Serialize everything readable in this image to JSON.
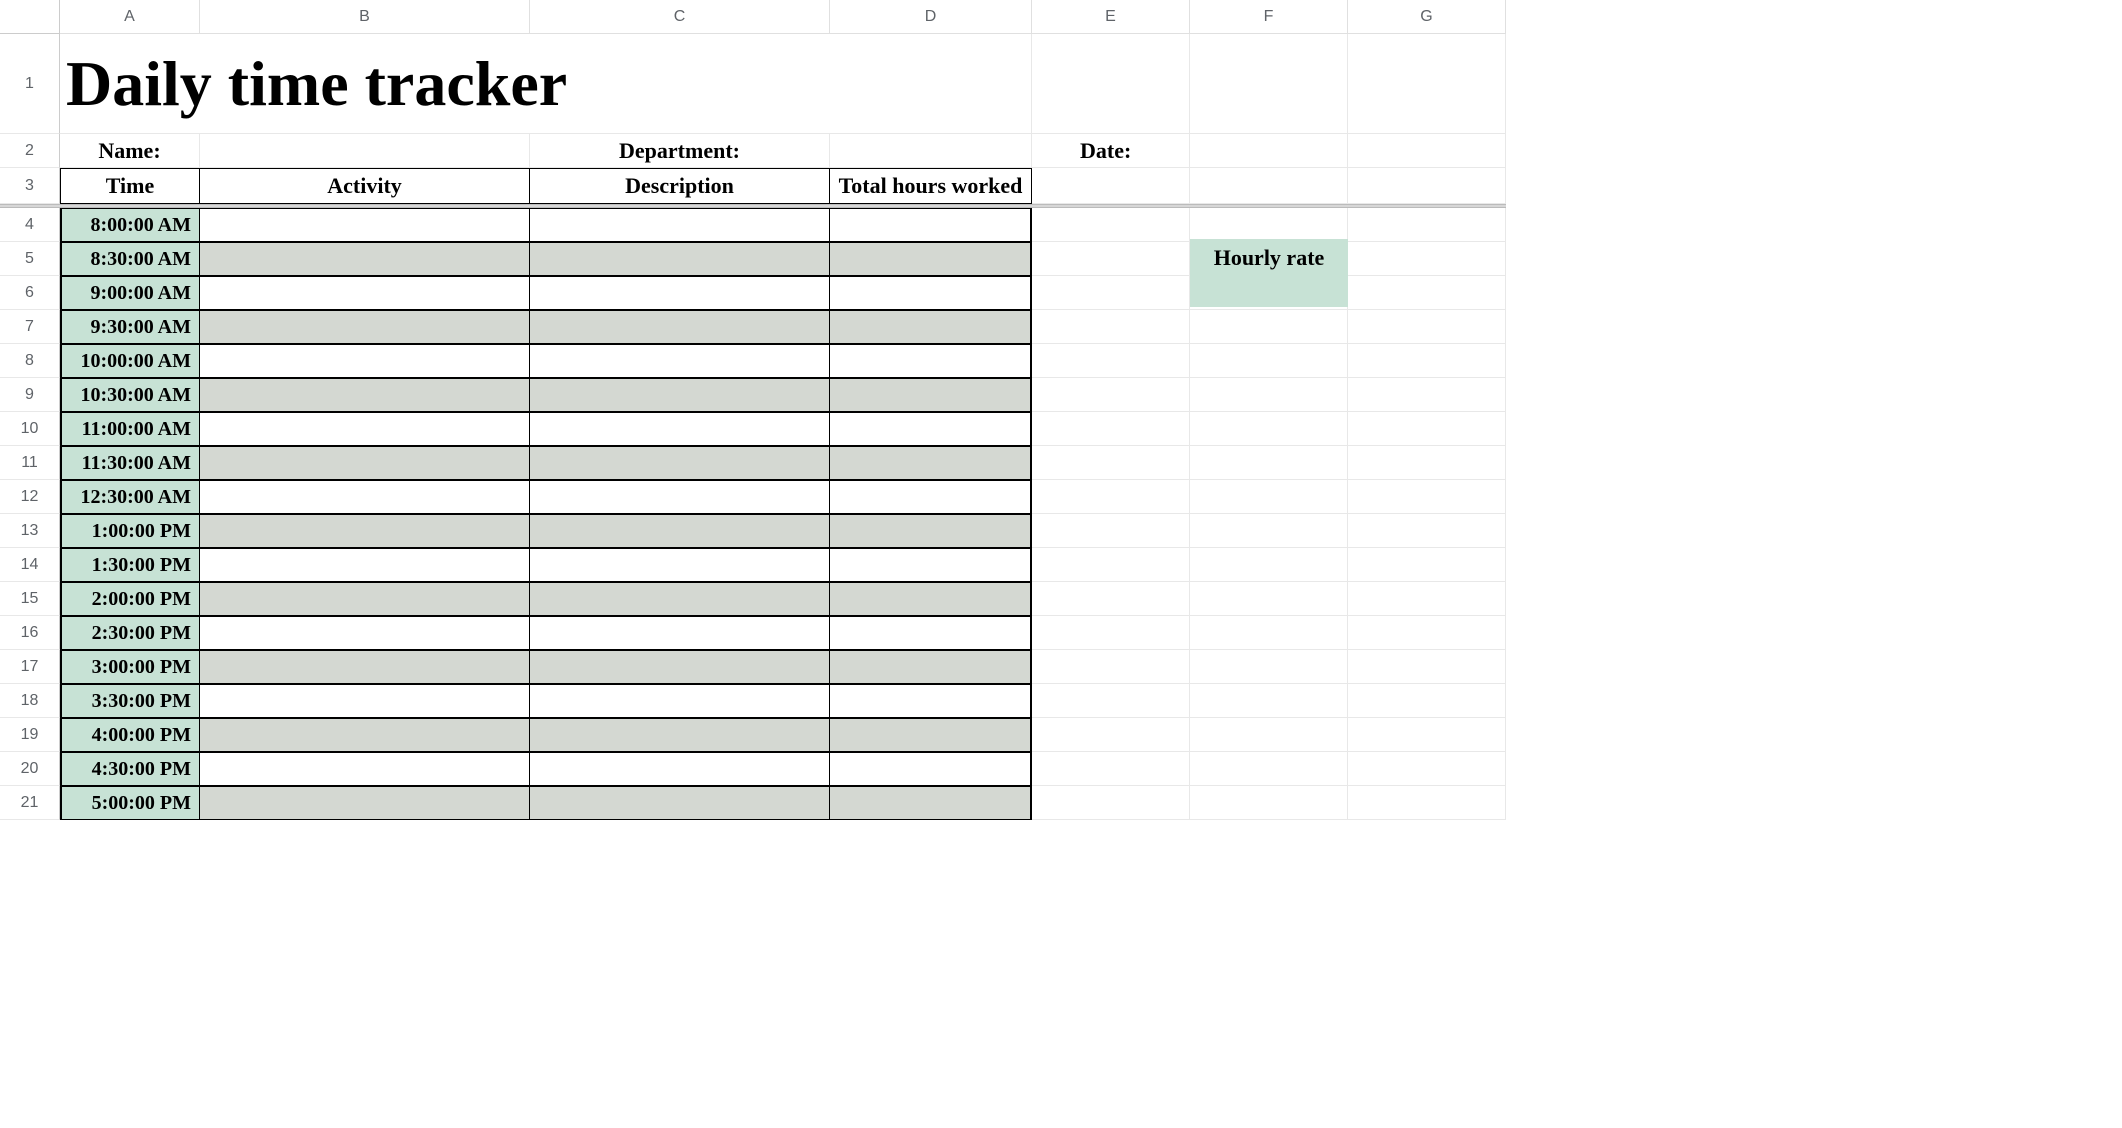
{
  "columns": [
    "A",
    "B",
    "C",
    "D",
    "E",
    "F",
    "G"
  ],
  "title": "Daily time tracker",
  "labels": {
    "name": "Name:",
    "department": "Department:",
    "date": "Date:"
  },
  "table_headers": {
    "time": "Time",
    "activity": "Activity",
    "description": "Description",
    "total_hours": "Total hours worked"
  },
  "times": [
    "8:00:00 AM",
    "8:30:00 AM",
    "9:00:00 AM",
    "9:30:00 AM",
    "10:00:00 AM",
    "10:30:00 AM",
    "11:00:00 AM",
    "11:30:00 AM",
    "12:30:00 AM",
    "1:00:00 PM",
    "1:30:00 PM",
    "2:00:00 PM",
    "2:30:00 PM",
    "3:00:00 PM",
    "3:30:00 PM",
    "4:00:00 PM",
    "4:30:00 PM",
    "5:00:00 PM"
  ],
  "hourly_rate_label": "Hourly rate",
  "row_numbers_start": 1
}
